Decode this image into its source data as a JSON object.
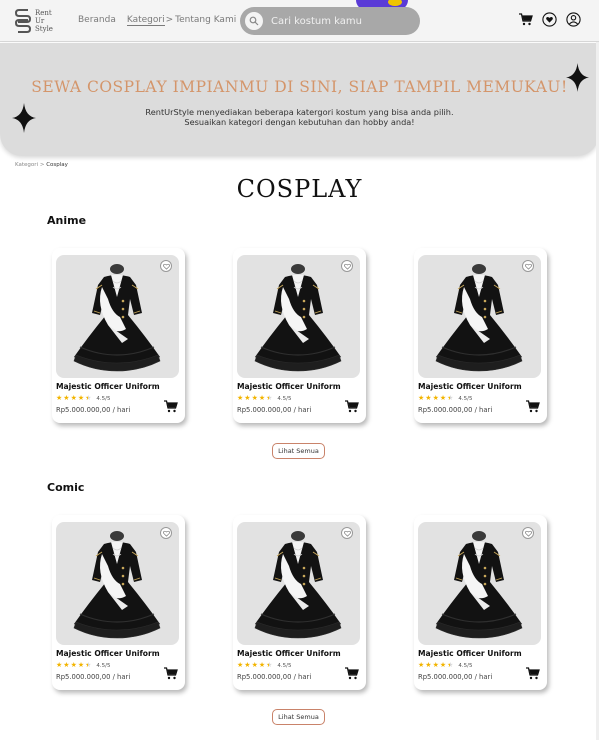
{
  "brand": {
    "logo_text": [
      "Rent",
      "Ur",
      "Style"
    ]
  },
  "nav": {
    "items": [
      {
        "label": "Beranda"
      },
      {
        "label": "Kategori"
      },
      {
        "label": "Tentang Kami"
      }
    ],
    "separator": ">"
  },
  "search": {
    "placeholder": "Cari kostum kamu"
  },
  "header_icons": [
    "cart-icon",
    "favorites-icon",
    "user-icon"
  ],
  "hero": {
    "title": "SEWA COSPLAY IMPIANMU DI SINI, SIAP TAMPIL MEMUKAU!",
    "subtitle_line1": "RentUrStyle menyediakan beberapa katergori kostum yang bisa anda pilih.",
    "subtitle_line2": "Sesuaikan kategori dengan kebutuhan dan hobby anda!"
  },
  "breadcrumb": {
    "parent": "Kategori",
    "separator": ">",
    "current": "Cosplay"
  },
  "page_title": "COSPLAY",
  "sections": [
    {
      "title": "Anime",
      "see_all": "Lihat Semua",
      "products": [
        {
          "name": "Majestic Officer Uniform",
          "rating": "4.5/5",
          "stars": 4.5,
          "price": "Rp5.000.000,00 / hari"
        },
        {
          "name": "Majestic Officer Uniform",
          "rating": "4.5/5",
          "stars": 4.5,
          "price": "Rp5.000.000,00 / hari"
        },
        {
          "name": "Majestic Officer Uniform",
          "rating": "4.5/5",
          "stars": 4.5,
          "price": "Rp5.000.000,00 / hari"
        }
      ]
    },
    {
      "title": "Comic",
      "see_all": "Lihat Semua",
      "products": [
        {
          "name": "Majestic Officer Uniform",
          "rating": "4.5/5",
          "stars": 4.5,
          "price": "Rp5.000.000,00 / hari"
        },
        {
          "name": "Majestic Officer Uniform",
          "rating": "4.5/5",
          "stars": 4.5,
          "price": "Rp5.000.000,00 / hari"
        },
        {
          "name": "Majestic Officer Uniform",
          "rating": "4.5/5",
          "stars": 4.5,
          "price": "Rp5.000.000,00 / hari"
        }
      ]
    }
  ],
  "colors": {
    "hero_title": "#d4956a",
    "hero_bg": "#dcdcdc",
    "star": "#f2b400",
    "button_border": "#c9836a",
    "search_bg": "#a8a8a8"
  }
}
